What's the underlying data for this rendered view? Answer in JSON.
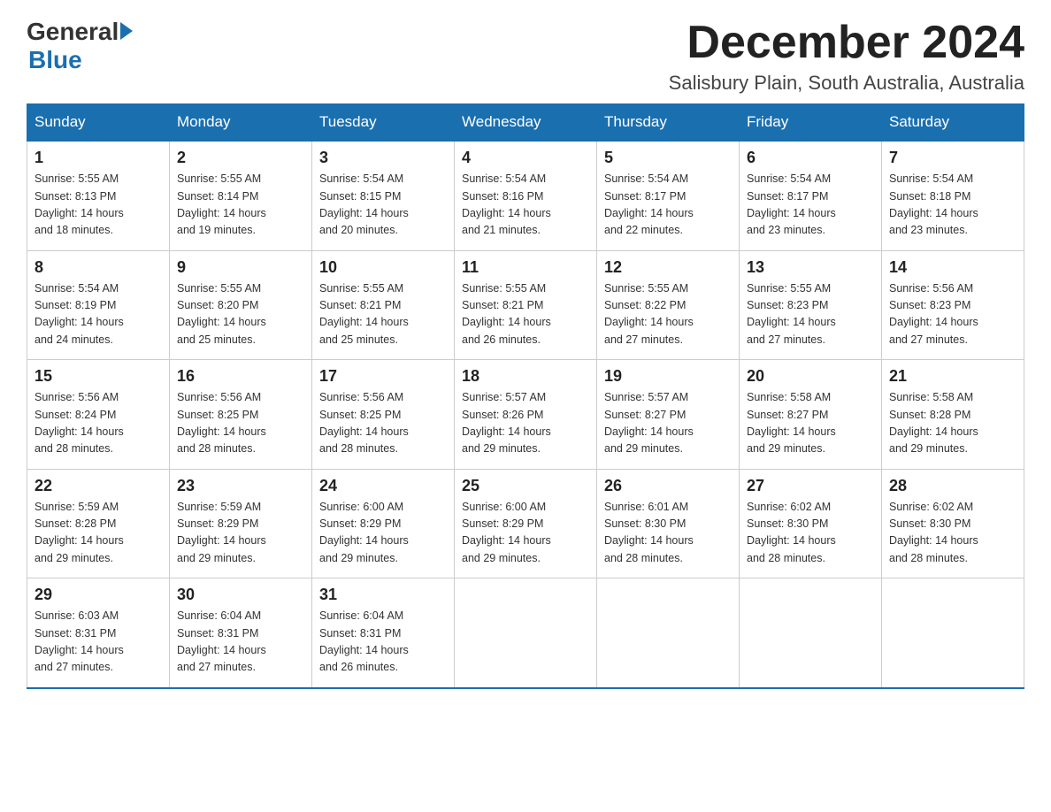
{
  "header": {
    "logo_general": "General",
    "logo_blue": "Blue",
    "month_title": "December 2024",
    "location": "Salisbury Plain, South Australia, Australia"
  },
  "days_of_week": [
    "Sunday",
    "Monday",
    "Tuesday",
    "Wednesday",
    "Thursday",
    "Friday",
    "Saturday"
  ],
  "weeks": [
    [
      {
        "day": "1",
        "sunrise": "5:55 AM",
        "sunset": "8:13 PM",
        "daylight": "14 hours and 18 minutes."
      },
      {
        "day": "2",
        "sunrise": "5:55 AM",
        "sunset": "8:14 PM",
        "daylight": "14 hours and 19 minutes."
      },
      {
        "day": "3",
        "sunrise": "5:54 AM",
        "sunset": "8:15 PM",
        "daylight": "14 hours and 20 minutes."
      },
      {
        "day": "4",
        "sunrise": "5:54 AM",
        "sunset": "8:16 PM",
        "daylight": "14 hours and 21 minutes."
      },
      {
        "day": "5",
        "sunrise": "5:54 AM",
        "sunset": "8:17 PM",
        "daylight": "14 hours and 22 minutes."
      },
      {
        "day": "6",
        "sunrise": "5:54 AM",
        "sunset": "8:17 PM",
        "daylight": "14 hours and 23 minutes."
      },
      {
        "day": "7",
        "sunrise": "5:54 AM",
        "sunset": "8:18 PM",
        "daylight": "14 hours and 23 minutes."
      }
    ],
    [
      {
        "day": "8",
        "sunrise": "5:54 AM",
        "sunset": "8:19 PM",
        "daylight": "14 hours and 24 minutes."
      },
      {
        "day": "9",
        "sunrise": "5:55 AM",
        "sunset": "8:20 PM",
        "daylight": "14 hours and 25 minutes."
      },
      {
        "day": "10",
        "sunrise": "5:55 AM",
        "sunset": "8:21 PM",
        "daylight": "14 hours and 25 minutes."
      },
      {
        "day": "11",
        "sunrise": "5:55 AM",
        "sunset": "8:21 PM",
        "daylight": "14 hours and 26 minutes."
      },
      {
        "day": "12",
        "sunrise": "5:55 AM",
        "sunset": "8:22 PM",
        "daylight": "14 hours and 27 minutes."
      },
      {
        "day": "13",
        "sunrise": "5:55 AM",
        "sunset": "8:23 PM",
        "daylight": "14 hours and 27 minutes."
      },
      {
        "day": "14",
        "sunrise": "5:56 AM",
        "sunset": "8:23 PM",
        "daylight": "14 hours and 27 minutes."
      }
    ],
    [
      {
        "day": "15",
        "sunrise": "5:56 AM",
        "sunset": "8:24 PM",
        "daylight": "14 hours and 28 minutes."
      },
      {
        "day": "16",
        "sunrise": "5:56 AM",
        "sunset": "8:25 PM",
        "daylight": "14 hours and 28 minutes."
      },
      {
        "day": "17",
        "sunrise": "5:56 AM",
        "sunset": "8:25 PM",
        "daylight": "14 hours and 28 minutes."
      },
      {
        "day": "18",
        "sunrise": "5:57 AM",
        "sunset": "8:26 PM",
        "daylight": "14 hours and 29 minutes."
      },
      {
        "day": "19",
        "sunrise": "5:57 AM",
        "sunset": "8:27 PM",
        "daylight": "14 hours and 29 minutes."
      },
      {
        "day": "20",
        "sunrise": "5:58 AM",
        "sunset": "8:27 PM",
        "daylight": "14 hours and 29 minutes."
      },
      {
        "day": "21",
        "sunrise": "5:58 AM",
        "sunset": "8:28 PM",
        "daylight": "14 hours and 29 minutes."
      }
    ],
    [
      {
        "day": "22",
        "sunrise": "5:59 AM",
        "sunset": "8:28 PM",
        "daylight": "14 hours and 29 minutes."
      },
      {
        "day": "23",
        "sunrise": "5:59 AM",
        "sunset": "8:29 PM",
        "daylight": "14 hours and 29 minutes."
      },
      {
        "day": "24",
        "sunrise": "6:00 AM",
        "sunset": "8:29 PM",
        "daylight": "14 hours and 29 minutes."
      },
      {
        "day": "25",
        "sunrise": "6:00 AM",
        "sunset": "8:29 PM",
        "daylight": "14 hours and 29 minutes."
      },
      {
        "day": "26",
        "sunrise": "6:01 AM",
        "sunset": "8:30 PM",
        "daylight": "14 hours and 28 minutes."
      },
      {
        "day": "27",
        "sunrise": "6:02 AM",
        "sunset": "8:30 PM",
        "daylight": "14 hours and 28 minutes."
      },
      {
        "day": "28",
        "sunrise": "6:02 AM",
        "sunset": "8:30 PM",
        "daylight": "14 hours and 28 minutes."
      }
    ],
    [
      {
        "day": "29",
        "sunrise": "6:03 AM",
        "sunset": "8:31 PM",
        "daylight": "14 hours and 27 minutes."
      },
      {
        "day": "30",
        "sunrise": "6:04 AM",
        "sunset": "8:31 PM",
        "daylight": "14 hours and 27 minutes."
      },
      {
        "day": "31",
        "sunrise": "6:04 AM",
        "sunset": "8:31 PM",
        "daylight": "14 hours and 26 minutes."
      },
      null,
      null,
      null,
      null
    ]
  ],
  "labels": {
    "sunrise_prefix": "Sunrise: ",
    "sunset_prefix": "Sunset: ",
    "daylight_prefix": "Daylight: "
  }
}
